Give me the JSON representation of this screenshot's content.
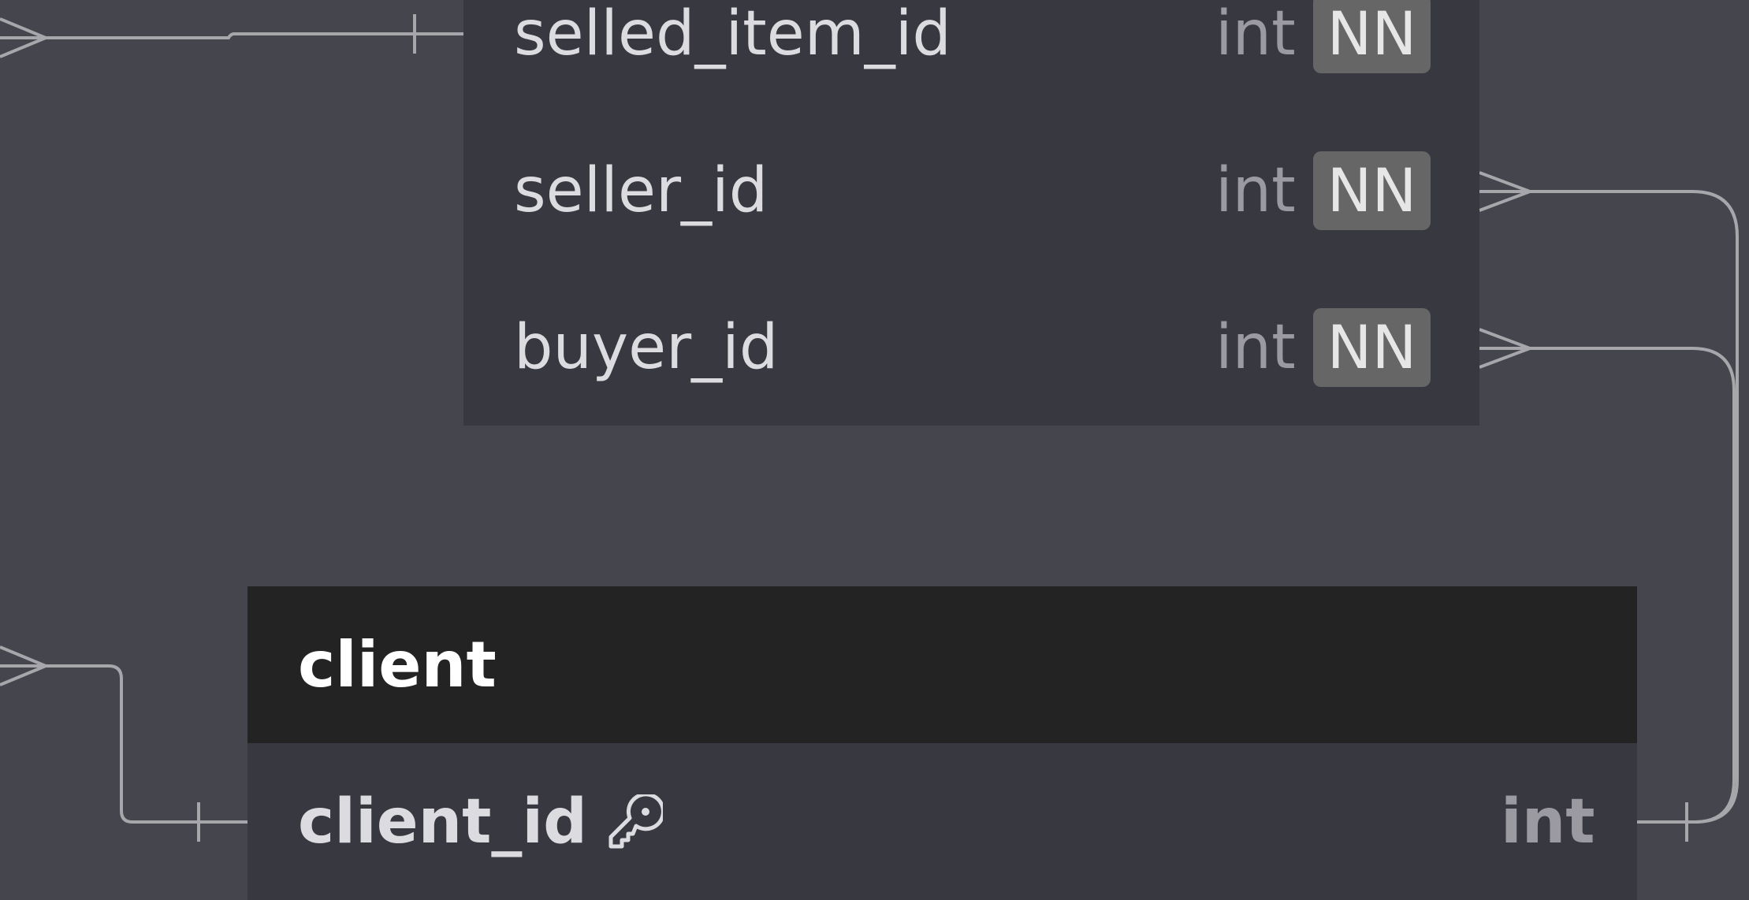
{
  "colors": {
    "canvas": "#45454e",
    "table_header": "#232323",
    "table_body": "#383841",
    "column_text": "#dcdce0",
    "type_text": "#9a9aa0",
    "badge_bg": "#666666",
    "connector": "#a6a6ab"
  },
  "tables": [
    {
      "id": "sale",
      "columns": [
        {
          "name": "selled_item_id",
          "type": "int",
          "constraint": "NN"
        },
        {
          "name": "seller_id",
          "type": "int",
          "constraint": "NN"
        },
        {
          "name": "buyer_id",
          "type": "int",
          "constraint": "NN"
        }
      ]
    },
    {
      "id": "client",
      "title": "client",
      "columns": [
        {
          "name": "client_id",
          "type": "int",
          "primary_key": true,
          "icon": "key-icon"
        }
      ]
    }
  ],
  "relationships": [
    {
      "from": "unseen-table",
      "to": "sale.selled_item_id",
      "from_end": "crow-foot-many",
      "to_end": "one"
    },
    {
      "from": "sale.seller_id",
      "to": "client.client_id",
      "from_end": "crow-foot-many",
      "to_end": "one"
    },
    {
      "from": "sale.buyer_id",
      "to": "client.client_id",
      "from_end": "crow-foot-many",
      "to_end": "one"
    },
    {
      "from": "unseen-table",
      "to": "client.client_id",
      "from_end": "crow-foot-many",
      "to_end": "one"
    }
  ]
}
